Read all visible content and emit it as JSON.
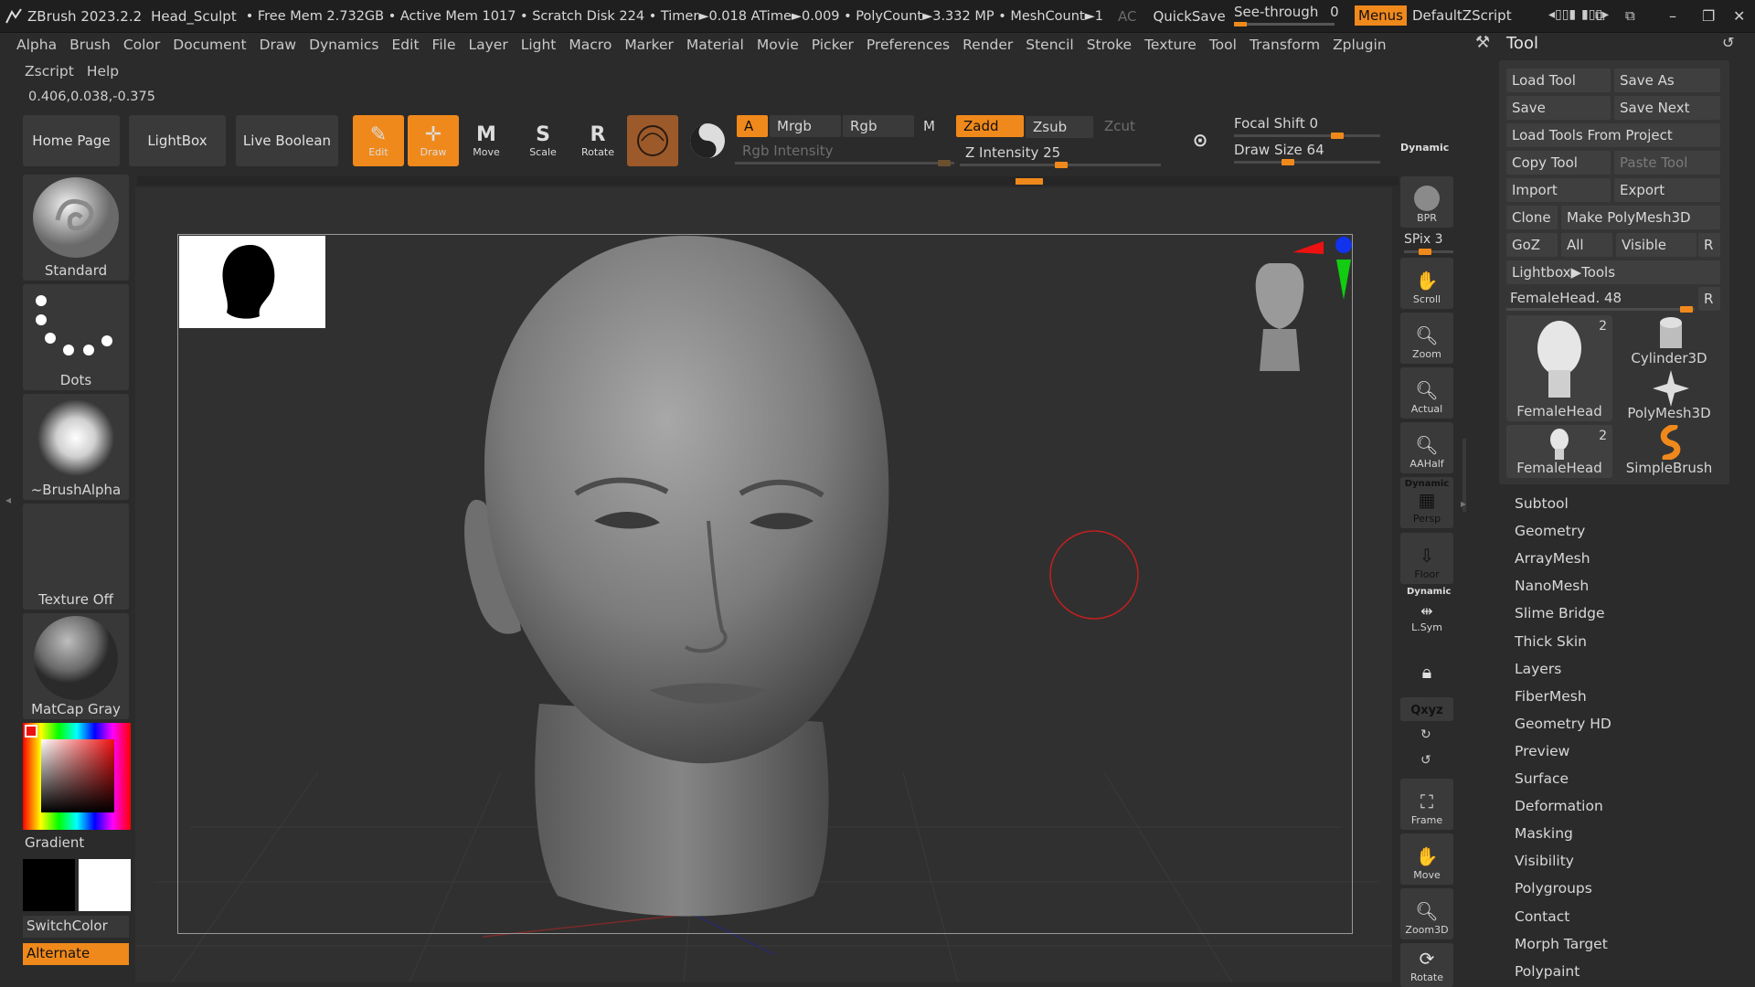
{
  "titlebar": {
    "app": "ZBrush 2023.2.2",
    "document": "Head_Sculpt",
    "status": "• Free Mem 2.732GB • Active Mem 1017 • Scratch Disk 224 • Timer►0.018 ATime►0.009 • PolyCount►3.332 MP • MeshCount►1",
    "ac": "AC",
    "quicksave": "QuickSave",
    "see_through_label": "See-through",
    "see_through_value": "0",
    "see_through_level": 0,
    "menus": "Menus",
    "script": "DefaultZScript"
  },
  "menubar": {
    "row1": [
      "Alpha",
      "Brush",
      "Color",
      "Document",
      "Draw",
      "Dynamics",
      "Edit",
      "File",
      "Layer",
      "Light",
      "Macro",
      "Marker",
      "Material",
      "Movie",
      "Picker",
      "Preferences",
      "Render",
      "Stencil",
      "Stroke",
      "Texture",
      "Tool",
      "Transform",
      "Zplugin"
    ],
    "row2": [
      "Zscript",
      "Help"
    ]
  },
  "coords": "0.406,0.038,-0.375",
  "toolbar": {
    "home": "Home Page",
    "lightbox": "LightBox",
    "live_boolean": "Live Boolean",
    "edit": "Edit",
    "draw": "Draw",
    "move": "Move",
    "scale": "Scale",
    "rotate": "Rotate",
    "a": "A",
    "mrgb": "Mrgb",
    "rgb": "Rgb",
    "m": "M",
    "zadd": "Zadd",
    "zsub": "Zsub",
    "zcut": "Zcut",
    "rgb_intensity": "Rgb Intensity",
    "z_intensity_label": "Z Intensity",
    "z_intensity": "25",
    "focal_shift_label": "Focal Shift",
    "focal_shift": "0",
    "draw_size_label": "Draw Size",
    "draw_size": "64",
    "dynamic": "Dynamic"
  },
  "left_shelf": {
    "brush": "Standard",
    "stroke": "Dots",
    "alpha": "~BrushAlpha",
    "texture": "Texture Off",
    "material": "MatCap Gray",
    "gradient": "Gradient",
    "switchcolor": "SwitchColor",
    "alternate": "Alternate"
  },
  "right_shelf": {
    "bpr": "BPR",
    "spix_label": "SPix",
    "spix": "3",
    "scroll": "Scroll",
    "zoom": "Zoom",
    "actual": "Actual",
    "aahalf": "AAHalf",
    "dynamic": "Dynamic",
    "persp": "Persp",
    "floor": "Floor",
    "dynamic2": "Dynamic",
    "lsym": "L.Sym",
    "xyz": "Qxyz",
    "frame": "Frame",
    "move": "Move",
    "zoom3d": "Zoom3D",
    "rotate": "Rotate"
  },
  "tool_palette": {
    "title": "Tool",
    "load_tool": "Load Tool",
    "save_as": "Save As",
    "save": "Save",
    "save_next": "Save Next",
    "load_from_project": "Load Tools From Project",
    "copy_tool": "Copy Tool",
    "paste_tool": "Paste Tool",
    "import": "Import",
    "export": "Export",
    "clone": "Clone",
    "make_polymesh": "Make PolyMesh3D",
    "goz": "GoZ",
    "all": "All",
    "visible": "Visible",
    "r": "R",
    "lightbox_tools": "Lightbox▶Tools",
    "current_tool": "FemaleHead. 48",
    "tools": [
      {
        "name": "FemaleHead",
        "count": "2"
      },
      {
        "name": "Cylinder3D",
        "count": ""
      },
      {
        "name": "PolyMesh3D",
        "count": ""
      },
      {
        "name": "FemaleHead",
        "count": "2"
      },
      {
        "name": "SimpleBrush",
        "count": ""
      }
    ],
    "submenus": [
      "Subtool",
      "Geometry",
      "ArrayMesh",
      "NanoMesh",
      "Slime Bridge",
      "Thick Skin",
      "Layers",
      "FiberMesh",
      "Geometry HD",
      "Preview",
      "Surface",
      "Deformation",
      "Masking",
      "Visibility",
      "Polygroups",
      "Contact",
      "Morph Target",
      "Polypaint"
    ]
  },
  "colors": {
    "accent": "#f0891b",
    "background": "#2b2b2b",
    "canvas": "#303030"
  }
}
